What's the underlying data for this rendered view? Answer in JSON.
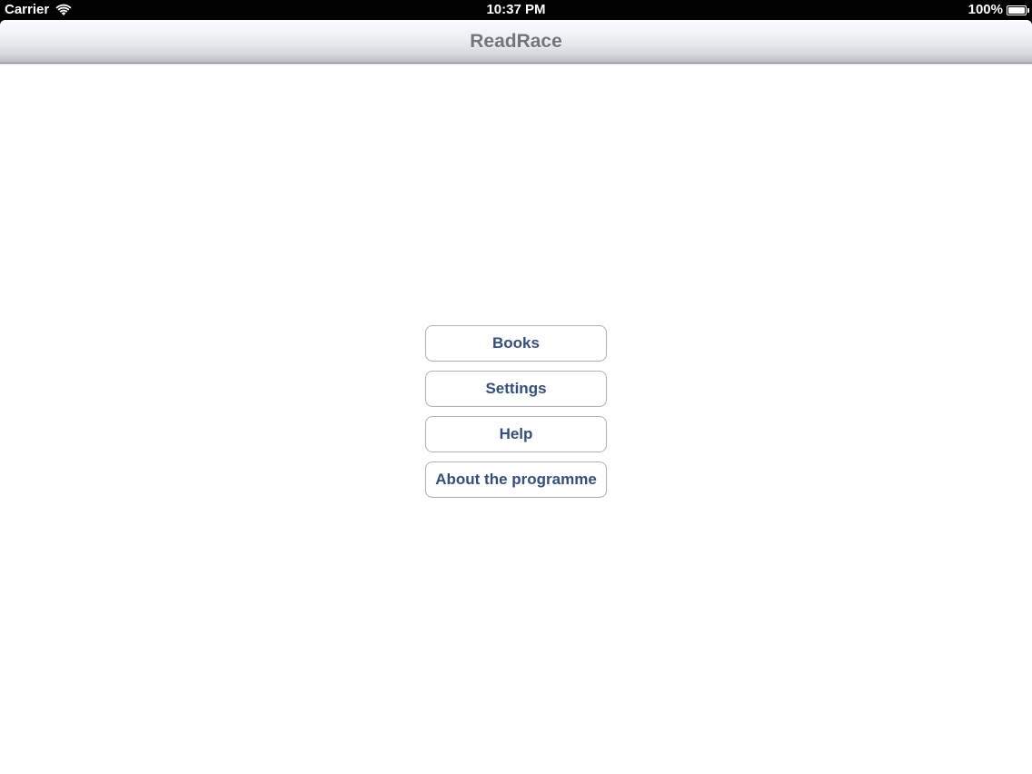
{
  "status_bar": {
    "carrier": "Carrier",
    "time": "10:37 PM",
    "battery_text": "100%",
    "wifi_icon": "wifi-icon",
    "battery_icon": "battery-icon",
    "battery_level": 1.0
  },
  "nav_bar": {
    "title": "ReadRace"
  },
  "menu": {
    "items": [
      {
        "label": "Books"
      },
      {
        "label": "Settings"
      },
      {
        "label": "Help"
      },
      {
        "label": "About the programme"
      }
    ]
  },
  "colors": {
    "button_text": "#354e7c",
    "title_text": "#71747c",
    "button_border": "#aeb0b6"
  }
}
